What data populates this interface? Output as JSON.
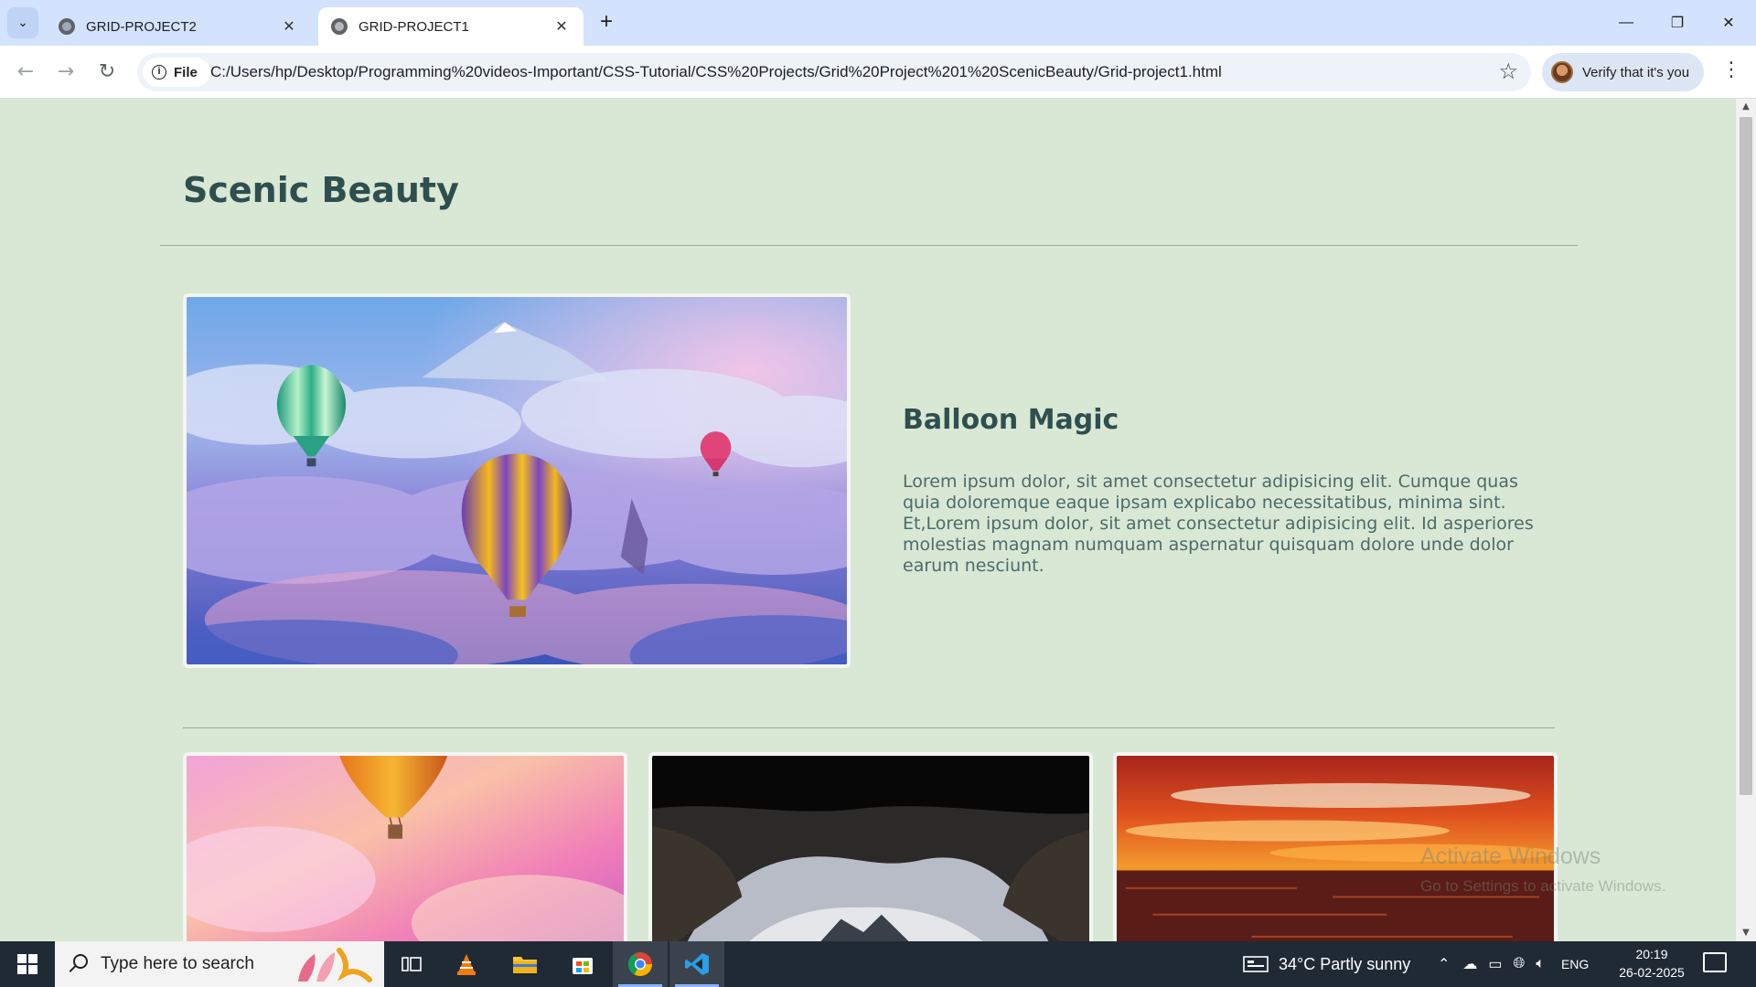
{
  "browser": {
    "tabs": [
      {
        "title": "GRID-PROJECT2",
        "active": false
      },
      {
        "title": "GRID-PROJECT1",
        "active": true
      }
    ],
    "site_chip": "File",
    "url": "C:/Users/hp/Desktop/Programming%20videos-Important/CSS-Tutorial/CSS%20Projects/Grid%20Project%201%20ScenicBeauty/Grid-project1.html",
    "verify_label": "Verify that it's you"
  },
  "page": {
    "title": "Scenic Beauty",
    "feature": {
      "title": "Balloon Magic",
      "text": "Lorem ipsum dolor, sit amet consectetur adipisicing elit. Cumque quas quia doloremque eaque ipsam explicabo necessitatibus, minima sint. Et,Lorem ipsum dolor, sit amet consectetur adipisicing elit. Id asperiores molestias magnam numquam aspernatur quisquam dolore unde dolor earum nesciunt."
    },
    "watermark": {
      "line1": "Activate Windows",
      "line2": "Go to Settings to activate Windows."
    }
  },
  "taskbar": {
    "search_placeholder": "Type here to search",
    "weather": "34°C  Partly sunny",
    "language": "ENG",
    "time": "20:19",
    "date": "26-02-2025",
    "pinned_icons": [
      "task-view-icon",
      "vlc-icon",
      "file-explorer-icon",
      "microsoft-store-icon",
      "chrome-icon",
      "vscode-icon"
    ]
  },
  "colors": {
    "page_background": "#d8e8d4",
    "heading": "#2f4f4f",
    "body_text": "#4e6a6a",
    "tab_strip": "#d3e3fd",
    "taskbar": "#1f2a35"
  }
}
